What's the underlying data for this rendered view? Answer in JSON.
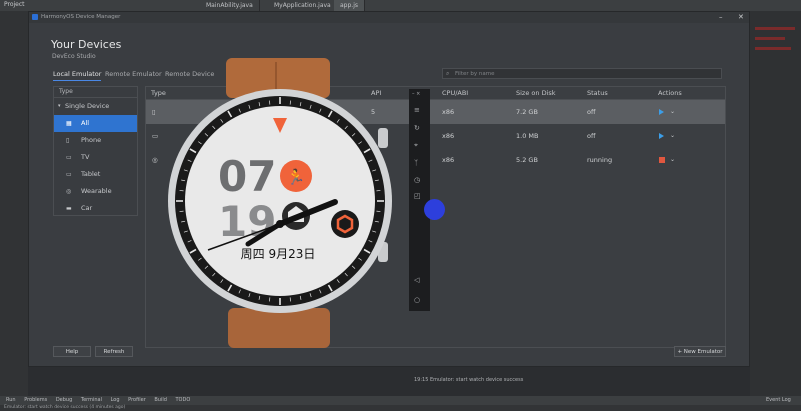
{
  "ide": {
    "project_label": "Project",
    "tabs": [
      "MainAbility.java",
      "MyApplication.java",
      "app.js"
    ],
    "active_tab_index": 2
  },
  "window": {
    "title": "HarmonyOS Device Manager",
    "heading": "Your Devices",
    "subheading": "DevEco Studio",
    "tabs": [
      "Local Emulator",
      "Remote Emulator",
      "Remote Device"
    ],
    "active_tab_index": 0,
    "filter_placeholder": "Filter by name"
  },
  "type_panel": {
    "header": "Type",
    "group": "Single Device",
    "items": [
      {
        "label": "All",
        "icon": "grid-icon",
        "selected": true
      },
      {
        "label": "Phone",
        "icon": "phone-icon",
        "selected": false
      },
      {
        "label": "TV",
        "icon": "tv-icon",
        "selected": false
      },
      {
        "label": "Tablet",
        "icon": "tablet-icon",
        "selected": false
      },
      {
        "label": "Wearable",
        "icon": "watch-icon",
        "selected": false
      },
      {
        "label": "Car",
        "icon": "car-icon",
        "selected": false
      }
    ]
  },
  "table": {
    "columns": [
      "Type",
      "",
      "API",
      "CPU/ABI",
      "Size on Disk",
      "Status",
      "Actions"
    ],
    "rows": [
      {
        "api": "5",
        "cpu": "x86",
        "size": "7.2 GB",
        "status": "off",
        "action": "play",
        "highlight": true
      },
      {
        "api": "",
        "cpu": "x86",
        "size": "1.0 MB",
        "status": "off",
        "action": "play",
        "highlight": false
      },
      {
        "api": "",
        "cpu": "x86",
        "size": "5.2 GB",
        "status": "running",
        "action": "stop",
        "highlight": false
      }
    ]
  },
  "buttons": {
    "help": "Help",
    "refresh": "Refresh",
    "new_emulator": "+ New Emulator"
  },
  "watch": {
    "hour": "07",
    "minute": "19",
    "date": "周四 9月23日"
  },
  "log": {
    "line": "19:15  Emulator: start watch device success"
  },
  "bottom_bar": {
    "items": [
      "Run",
      "Problems",
      "Debug",
      "Terminal",
      "Log",
      "Profiler",
      "Build",
      "TODO"
    ],
    "event_log": "Event Log"
  },
  "status_bar": {
    "message": "Emulator: start watch device success (4 minutes ago)"
  },
  "colors": {
    "accent": "#2f74d0",
    "play": "#3c9ee8",
    "stop": "#e0573f",
    "watch_orange": "#f0633a"
  }
}
